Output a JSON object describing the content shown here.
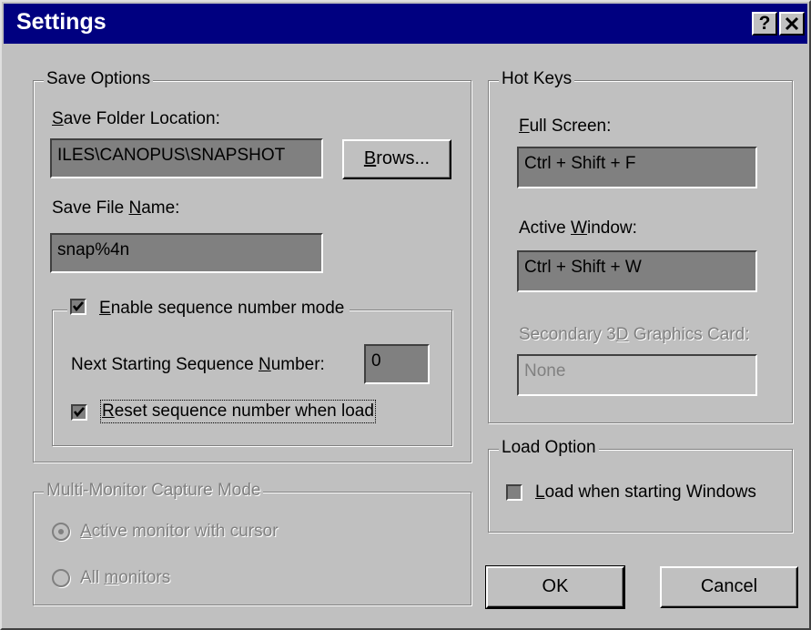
{
  "window": {
    "title": "Settings",
    "help_button": "?",
    "close_button": "✕"
  },
  "save_options": {
    "legend": "Save Options",
    "folder_label_pre": "",
    "folder_label_key": "S",
    "folder_label_post": "ave Folder Location:",
    "folder_value": "ILES\\CANOPUS\\SNAPSHOT",
    "browse_key": "B",
    "browse_rest": "rows...",
    "file_label_pre": "Save File ",
    "file_label_key": "N",
    "file_label_post": "ame:",
    "file_value": "snap%4n",
    "sequence": {
      "enable_key": "E",
      "enable_rest": "nable sequence number mode",
      "enable_checked": true,
      "next_label_pre": "Next Starting Sequence ",
      "next_label_key": "N",
      "next_label_post": "umber:",
      "next_value": "0",
      "reset_key": "R",
      "reset_rest": "eset sequence number when load",
      "reset_checked": true
    }
  },
  "multi_monitor": {
    "legend": "Multi-Monitor Capture Mode",
    "option_active_key": "A",
    "option_active_rest": "ctive monitor with cursor",
    "option_all_pre": "All ",
    "option_all_key": "m",
    "option_all_rest": "onitors",
    "selected": "active"
  },
  "hot_keys": {
    "legend": "Hot Keys",
    "full_key": "F",
    "full_rest": "ull Screen:",
    "full_value": "Ctrl + Shift + F",
    "active_pre": "Active ",
    "active_key": "W",
    "active_post": "indow:",
    "active_value": "Ctrl + Shift + W",
    "secondary_pre": "Secondary 3",
    "secondary_key": "D",
    "secondary_post": " Graphics Card:",
    "secondary_value": "None"
  },
  "load_option": {
    "legend": "Load Option",
    "checkbox_key": "L",
    "checkbox_rest": "oad when starting Windows",
    "checked": false
  },
  "buttons": {
    "ok": "OK",
    "cancel": "Cancel"
  },
  "colors": {
    "title_bar": "#000080",
    "face": "#c0c0c0",
    "field": "#808080"
  }
}
